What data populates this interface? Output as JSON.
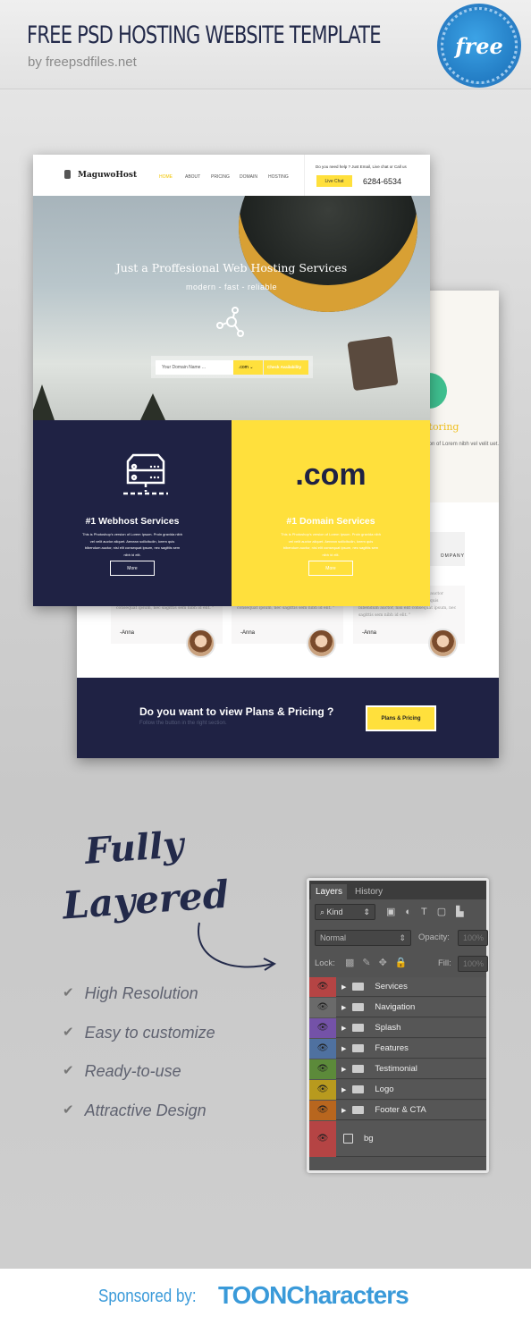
{
  "header": {
    "title": "FREE PSD HOSTING WEBSITE TEMPLATE",
    "byline": "by freepsdfiles.net",
    "badge": "free"
  },
  "front": {
    "logo": "MaguwoHost",
    "nav": [
      "HOME",
      "ABOUT",
      "PRICING",
      "DOMAIN",
      "HOSTING"
    ],
    "help": "Do you need help ? Just Email, Live chat or Call us",
    "live_chat": "Live Chat",
    "phone": "6284-6534",
    "hero_title": "Just a Proffesional Web Hosting Services",
    "hero_sub": "modern  -  fast  -  reliable",
    "search_placeholder": "Your Domain Name ...",
    "tld": ".com  ⌄",
    "check": "Check Availability",
    "services": [
      {
        "title": "#1 Webhost Services",
        "text": "This is Photoshop's version  of Lorem Ipsum. Proin gravida nibh vel velit auctor aliquet. Aenean sollicitudin, lorem quis bibendum auctor, nisi elit consequat ipsum, nec sagittis sem nibh id elit.",
        "button": "More"
      },
      {
        "title": "#1 Domain Services",
        "big": ".com",
        "text": "This is Photoshop's version  of Lorem Ipsum. Proin gravida nibh vel velit auctor aliquet. Aenean sollicitudin, lorem quis bibendum auctor, nisi elit consequat ipsum, nec sagittis sem nibh id elit.",
        "button": "More"
      }
    ]
  },
  "back": {
    "feature_title": "itoring",
    "feature_text": "ersion  of Lorem nibh vel velit uet.",
    "company": "OMPANY",
    "testimonials": [
      {
        "text": "gravida nibh vel velit auctor aliquet. Aenean sollicitudin, lorem quis bibendum auctor, nisi elit consequat ipsum, nec sagittis sem nibh id elit. \"",
        "name": "-Anna"
      },
      {
        "text": "gravida nibh vel velit auctor aliquet. Aenean sollicitudin, lorem quis bibendum auctor, nisi elit consequat ipsum, nec sagittis sem nibh id elit. \"",
        "name": "-Anna"
      },
      {
        "text": "Ipsum. Proin gravida nibh vel velit auctor aliquet. Aenean sollicitudin, lorem quis bibendum auctor, nisi elit consequat ipsum, nec sagittis sem nibh id elit. \"",
        "name": "-Anna"
      }
    ],
    "cta_title": "Do you want to view Plans & Pricing ?",
    "cta_sub": "Follow the button in the right section.",
    "cta_button": "Plans & Pricing"
  },
  "promo": {
    "line1": "Fully",
    "line2": "Layered",
    "features": [
      "High Resolution",
      "Easy to customize",
      "Ready-to-use",
      "Attractive Design"
    ]
  },
  "layers_panel": {
    "tabs": [
      "Layers",
      "History"
    ],
    "kind": "Kind",
    "blend": "Normal",
    "opacity_label": "Opacity:",
    "opacity": "100%",
    "lock_label": "Lock:",
    "fill_label": "Fill:",
    "fill": "100%",
    "layers": [
      {
        "name": "Services",
        "color": "#b54444"
      },
      {
        "name": "Navigation",
        "color": "#6a6a6a"
      },
      {
        "name": "Splash",
        "color": "#7452a8"
      },
      {
        "name": "Features",
        "color": "#4f71a0"
      },
      {
        "name": "Testimonial",
        "color": "#5c8a3a"
      },
      {
        "name": "Logo",
        "color": "#b89a1e"
      },
      {
        "name": "Footer & CTA",
        "color": "#b8661e"
      },
      {
        "name": "bg",
        "color": "#b54444"
      }
    ]
  },
  "sponsor": {
    "label": "Sponsored by:",
    "brand": "TOONCharacters"
  },
  "colors": {
    "navy": "#1f2244",
    "yellow": "#ffe03c",
    "blue": "#3a9ad9"
  }
}
